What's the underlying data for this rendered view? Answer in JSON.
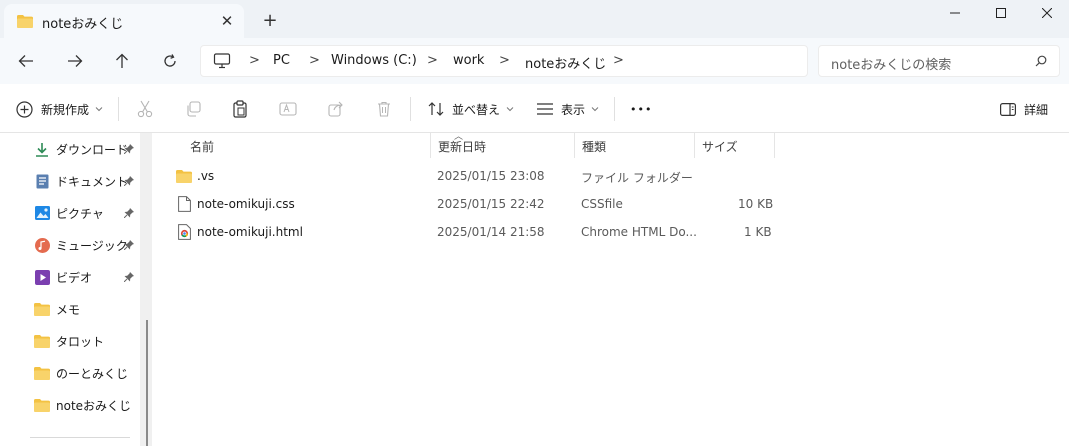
{
  "tab": {
    "title": "noteおみくじ",
    "close": "✕",
    "new_tab": "+"
  },
  "window_controls": {
    "minimize": "─",
    "maximize": "☐",
    "close": "✕"
  },
  "nav": {
    "breadcrumbs": [
      "PC",
      "Windows (C:)",
      "work",
      "noteおみくじ"
    ],
    "separator": ">",
    "search_placeholder": "noteおみくじの検索"
  },
  "commands": {
    "new": "新規作成",
    "sort": "並べ替え",
    "view": "表示",
    "more": "•••",
    "details": "詳細"
  },
  "sidebar": {
    "items": [
      {
        "label": "ダウンロード",
        "icon": "download-icon",
        "pinned": true
      },
      {
        "label": "ドキュメント",
        "icon": "document-icon",
        "pinned": true
      },
      {
        "label": "ピクチャ",
        "icon": "picture-icon",
        "pinned": true
      },
      {
        "label": "ミュージック",
        "icon": "music-icon",
        "pinned": true
      },
      {
        "label": "ビデオ",
        "icon": "video-icon",
        "pinned": true
      },
      {
        "label": "メモ",
        "icon": "folder-icon",
        "pinned": false
      },
      {
        "label": "タロット",
        "icon": "folder-icon",
        "pinned": false
      },
      {
        "label": "のーとみくじ",
        "icon": "folder-icon",
        "pinned": false
      },
      {
        "label": "noteおみくじ",
        "icon": "folder-icon",
        "pinned": false
      }
    ]
  },
  "columns": {
    "name": "名前",
    "modified": "更新日時",
    "type": "種類",
    "size": "サイズ"
  },
  "files": [
    {
      "name": ".vs",
      "modified": "2025/01/15 23:08",
      "type": "ファイル フォルダー",
      "size": "",
      "icon": "folder-icon"
    },
    {
      "name": "note-omikuji.css",
      "modified": "2025/01/15 22:42",
      "type": "CSSfile",
      "size": "10 KB",
      "icon": "blank-file-icon"
    },
    {
      "name": "note-omikuji.html",
      "modified": "2025/01/14 21:58",
      "type": "Chrome HTML Do...",
      "size": "1 KB",
      "icon": "chrome-icon"
    }
  ],
  "colors": {
    "folder": "#f3c243",
    "accent": "#0067c0",
    "titlebar": "#eef2f6"
  }
}
